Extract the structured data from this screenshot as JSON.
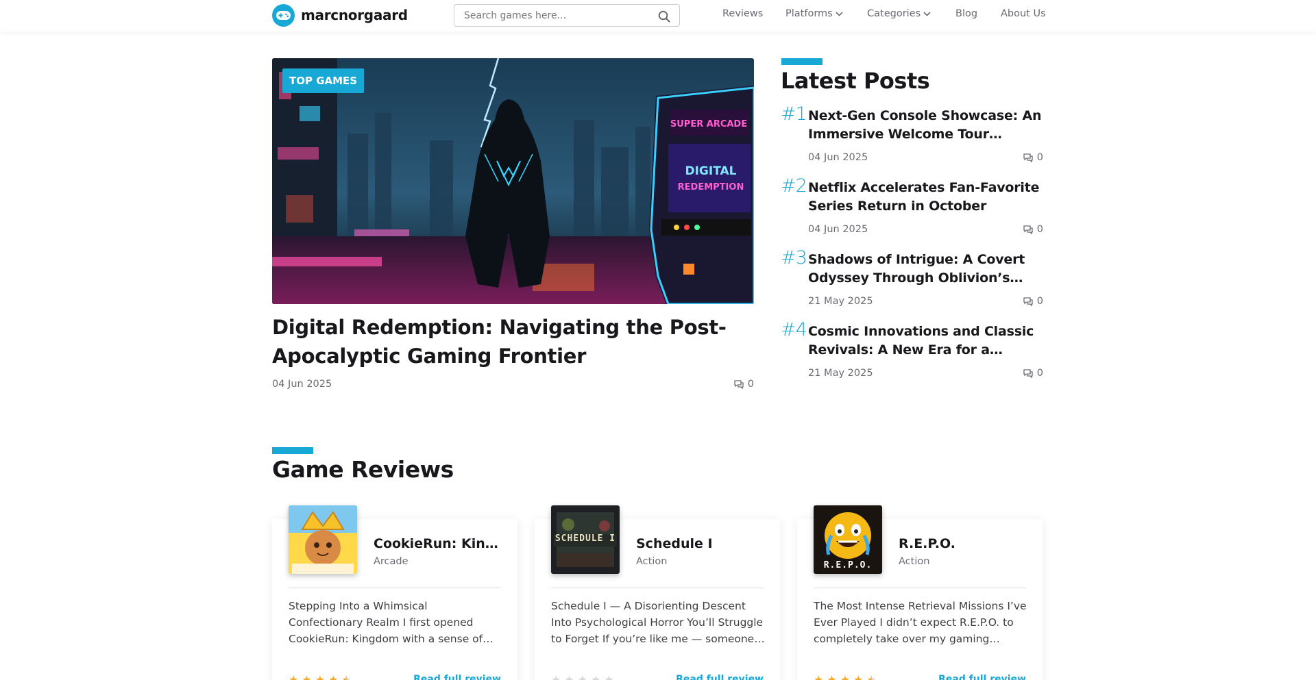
{
  "header": {
    "brand": "marcnorgaard",
    "search_placeholder": "Search games here...",
    "nav": [
      "Reviews",
      "Platforms",
      "Categories",
      "Blog",
      "About Us"
    ]
  },
  "hero": {
    "badge": "TOP GAMES",
    "image_icon": "cyberpunk-hooded-figure-arcade-image",
    "title": "Digital Redemption: Navigating the Post-Apocalyptic Gaming Frontier",
    "date": "04 Jun 2025",
    "comments": "0"
  },
  "latest": {
    "title": "Latest Posts",
    "posts": [
      {
        "num": "#1",
        "title": "Next-Gen Console Showcase: An Immersive Welcome Tour Experience",
        "date": "04 Jun 2025",
        "comments": "0"
      },
      {
        "num": "#2",
        "title": "Netflix Accelerates Fan-Favorite Series Return in October",
        "date": "04 Jun 2025",
        "comments": "0"
      },
      {
        "num": "#3",
        "title": "Shadows of Intrigue: A Covert Odyssey Through Oblivion’s Urban Underworld",
        "date": "21 May 2025",
        "comments": "0"
      },
      {
        "num": "#4",
        "title": "Cosmic Innovations and Classic Revivals: A New Era for a Beloved Franchise",
        "date": "21 May 2025",
        "comments": "0"
      }
    ]
  },
  "reviews": {
    "title": "Game Reviews",
    "items": [
      {
        "title": "CookieRun: Kingdom",
        "category": "Arcade",
        "text": "Stepping Into a Whimsical Confectionary Realm I first opened CookieRun: Kingdom with a sense of wonder akin to opening a box of freshly baked treats.",
        "rating": 4.5,
        "read_more": "Read full review"
      },
      {
        "title": "Schedule I",
        "category": "Action",
        "text": "Schedule I — A Disorienting Descent Into Psychological Horror You’ll Struggle to Forget If you’re like me — someone who loves unsettling games.",
        "rating": 0,
        "read_more": "Read full review",
        "thumb_text": "SCHEDULE I"
      },
      {
        "title": "R.E.P.O.",
        "category": "Action",
        "text": "The Most Intense Retrieval Missions I’ve Ever Played I didn’t expect R.E.P.O. to completely take over my gaming nights, but it did.",
        "rating": 4.5,
        "read_more": "Read full review",
        "thumb_text": "R.E.P.O."
      }
    ]
  },
  "colors": {
    "accent": "#17a8d6",
    "text": "#18181c",
    "muted": "#6b6b73",
    "star": "#f5a623",
    "star_empty": "#d6d6da"
  }
}
